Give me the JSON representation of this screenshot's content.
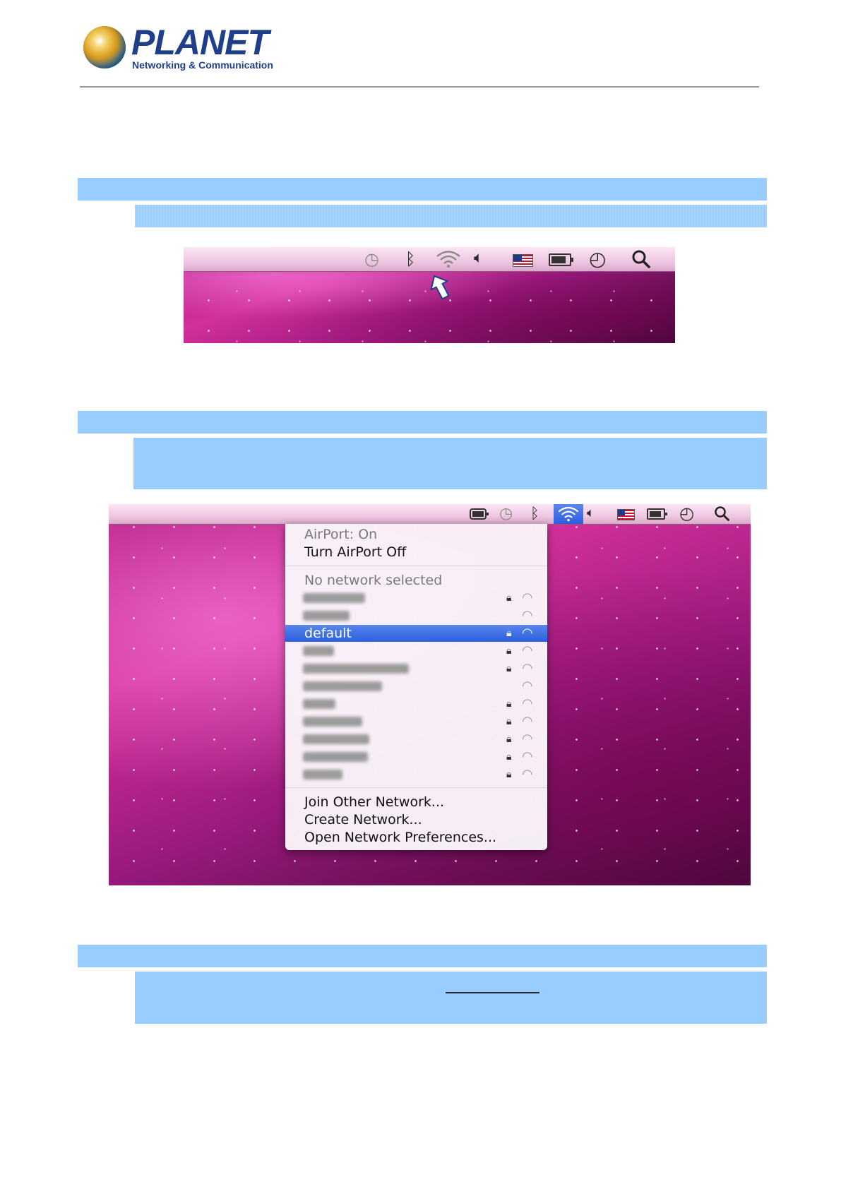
{
  "header": {
    "brand": "PLANET",
    "tagline": "Networking & Communication"
  },
  "screenshot1": {
    "menubar_icons": [
      "time-machine-icon",
      "bluetooth-icon",
      "wifi-icon",
      "volume-icon",
      "us-flag-icon",
      "battery-icon",
      "clock-icon",
      "spotlight-search-icon"
    ],
    "pointer": "arrow-up-icon"
  },
  "screenshot2": {
    "menubar_icons": [
      "battery-meter-icon",
      "time-machine-icon",
      "bluetooth-icon",
      "wifi-icon",
      "volume-icon",
      "us-flag-icon",
      "battery-icon",
      "clock-icon",
      "spotlight-search-icon"
    ],
    "menu": {
      "status": "AirPort: On",
      "toggle": "Turn AirPort Off",
      "no_network": "No network selected",
      "selected_network": "default",
      "actions": [
        "Join Other Network...",
        "Create Network...",
        "Open Network Preferences..."
      ]
    },
    "colors": {
      "selection": "#2c5fe0",
      "bar": "#99ccff"
    }
  }
}
